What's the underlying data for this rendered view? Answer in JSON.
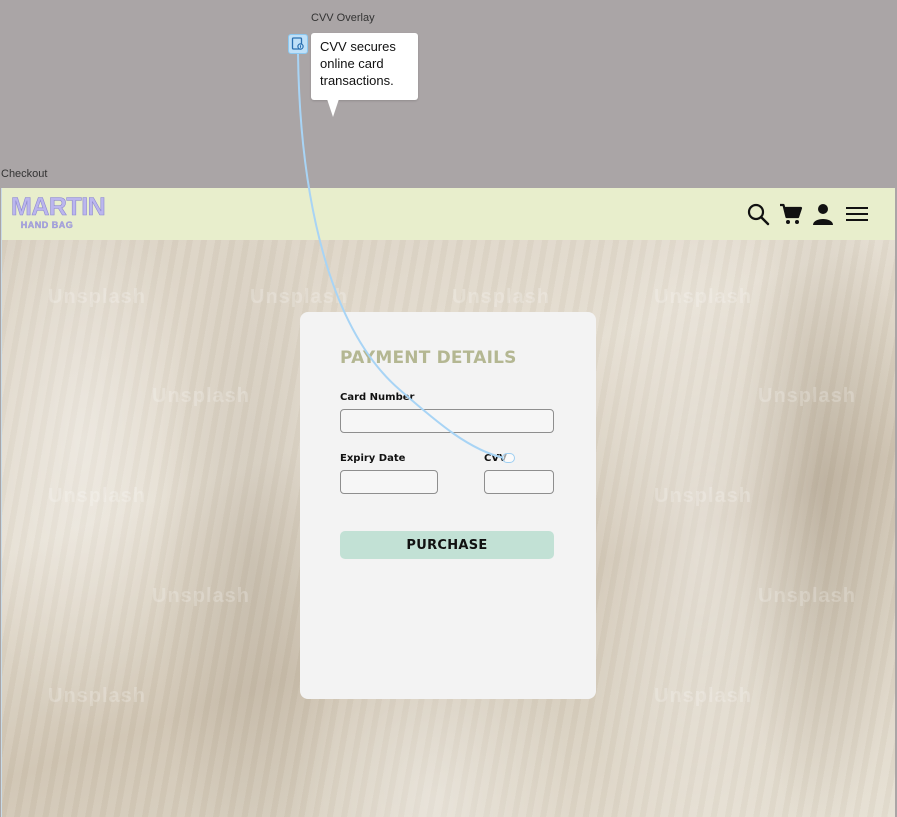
{
  "canvas": {
    "overlay_frame_label": "CVV Overlay",
    "checkout_frame_label": "Checkout"
  },
  "tooltip": {
    "text": "CVV secures online card transactions."
  },
  "header": {
    "logo_main": "MARTIN",
    "logo_sub": "HAND BAG",
    "icons": [
      "search-icon",
      "cart-icon",
      "user-icon",
      "menu-icon"
    ]
  },
  "background": {
    "watermark": "Unsplash"
  },
  "payment": {
    "title": "PAYMENT DETAILS",
    "card_number_label": "Card Number",
    "card_number_value": "",
    "expiry_label": "Expiry Date",
    "expiry_value": "",
    "cvv_label": "CVV",
    "cvv_value": "",
    "purchase_label": "PURCHASE"
  },
  "colors": {
    "canvas_bg": "#aaa5a6",
    "header_bg": "#e8eecc",
    "title_color": "#b4b792",
    "button_bg": "#c2e1d5",
    "logo_color": "#bbb6ee",
    "connector": "#a8d4f5"
  }
}
